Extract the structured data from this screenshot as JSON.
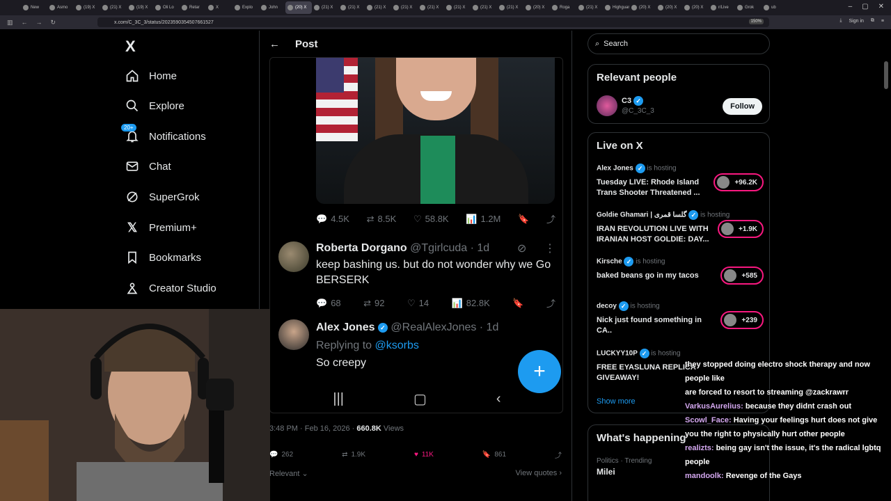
{
  "browser": {
    "tabs": [
      {
        "label": "New"
      },
      {
        "label": "Asmo"
      },
      {
        "label": "(19) X"
      },
      {
        "label": "(21) X"
      },
      {
        "label": "(19) X"
      },
      {
        "label": "Oli Lo"
      },
      {
        "label": "Retar"
      },
      {
        "label": "X"
      },
      {
        "label": "Explo"
      },
      {
        "label": "John"
      },
      {
        "label": "(20) X",
        "active": true
      },
      {
        "label": "(21) X"
      },
      {
        "label": "(21) X"
      },
      {
        "label": "(21) X"
      },
      {
        "label": "(21) X"
      },
      {
        "label": "(21) X"
      },
      {
        "label": "(21) X"
      },
      {
        "label": "(21) X"
      },
      {
        "label": "(21) X"
      },
      {
        "label": "(20) X"
      },
      {
        "label": "Roga"
      },
      {
        "label": "(21) X"
      },
      {
        "label": "Highguar"
      },
      {
        "label": "(20) X"
      },
      {
        "label": "(20) X"
      },
      {
        "label": "(20) X"
      },
      {
        "label": "r/Live"
      },
      {
        "label": "Grok"
      },
      {
        "label": "ub"
      }
    ],
    "url": "x.com/C_3C_3/status/2023590354507661527",
    "zoom": "150%",
    "signin": "Sign in"
  },
  "nav": {
    "logo": "X",
    "items": [
      {
        "label": "Home",
        "icon": "home-icon"
      },
      {
        "label": "Explore",
        "icon": "search-icon"
      },
      {
        "label": "Notifications",
        "icon": "bell-icon",
        "badge": "20+"
      },
      {
        "label": "Chat",
        "icon": "mail-icon"
      },
      {
        "label": "SuperGrok",
        "icon": "grok-icon"
      },
      {
        "label": "Premium+",
        "icon": "x-icon"
      },
      {
        "label": "Bookmarks",
        "icon": "bookmark-icon"
      },
      {
        "label": "Creator Studio",
        "icon": "person-icon"
      }
    ]
  },
  "post": {
    "header_title": "Post",
    "quoted_stats": {
      "replies": "4.5K",
      "reposts": "8.5K",
      "likes": "58.8K",
      "views": "1.2M"
    },
    "replies": [
      {
        "name": "Roberta Dorgano",
        "handle": "@Tgirlcuda · 1d",
        "text": "keep bashing us. but do not wonder why we Go BERSERK",
        "replies": "68",
        "reposts": "92",
        "likes": "14",
        "views": "82.8K"
      },
      {
        "name": "Alex Jones",
        "handle": "@RealAlexJones · 1d",
        "replying_prefix": "Replying to ",
        "replying_to": "@ksorbs",
        "text": "So creepy"
      }
    ],
    "timestamp": "3:48 PM · Feb 16, 2026 · ",
    "views_count": "660.8K",
    "views_label": " Views",
    "stats": {
      "replies": "262",
      "reposts": "1.9K",
      "likes": "11K",
      "bookmarks": "861"
    },
    "sort_label": "Relevant",
    "view_quotes": "View quotes"
  },
  "right": {
    "search_placeholder": "Search",
    "relevant_title": "Relevant people",
    "relevant_person": {
      "name": "C3",
      "handle": "@C_3C_3",
      "follow": "Follow"
    },
    "live_title": "Live on X",
    "live": [
      {
        "host": "Alex Jones",
        "status": "is hosting",
        "title": "Tuesday LIVE: Rhode Island Trans Shooter Threatened ...",
        "count": "+96.2K"
      },
      {
        "host": "Goldie Ghamari | گلسا قمری",
        "status": "is hosting",
        "title": "IRAN REVOLUTION LIVE WITH IRANIAN HOST GOLDIE: DAY...",
        "count": "+1.9K"
      },
      {
        "host": "Kirsche",
        "status": "is hosting",
        "title": "baked beans go in my tacos",
        "count": "+585"
      },
      {
        "host": "decoy",
        "status": "is hosting",
        "title": "Nick just found something in CA..",
        "count": "+239"
      },
      {
        "host": "LUCKYY10P",
        "status": "is hosting",
        "title": "FREE EYASLUNA REPLICA GIVEAWAY!",
        "count": ""
      }
    ],
    "show_more": "Show more",
    "happening_title": "What's happening",
    "trend": {
      "meta": "Politics · Trending",
      "name": "Milei"
    }
  },
  "chat": [
    {
      "user": "",
      "text": "they stopped doing electro shock therapy and now people like"
    },
    {
      "user": "",
      "text": "are forced to resort to streaming @zackrawrr"
    },
    {
      "user": "VarkusAurelius:",
      "text": "because they didnt crash out"
    },
    {
      "user": "Scowl_Face:",
      "text": "Having your feelings hurt does not give you the right to physically hurt other people"
    },
    {
      "user": "realizts:",
      "text": "being gay isn't the issue, it's the radical lgbtq people"
    },
    {
      "user": "mandoolk:",
      "text": "Revenge of the Gays"
    }
  ]
}
